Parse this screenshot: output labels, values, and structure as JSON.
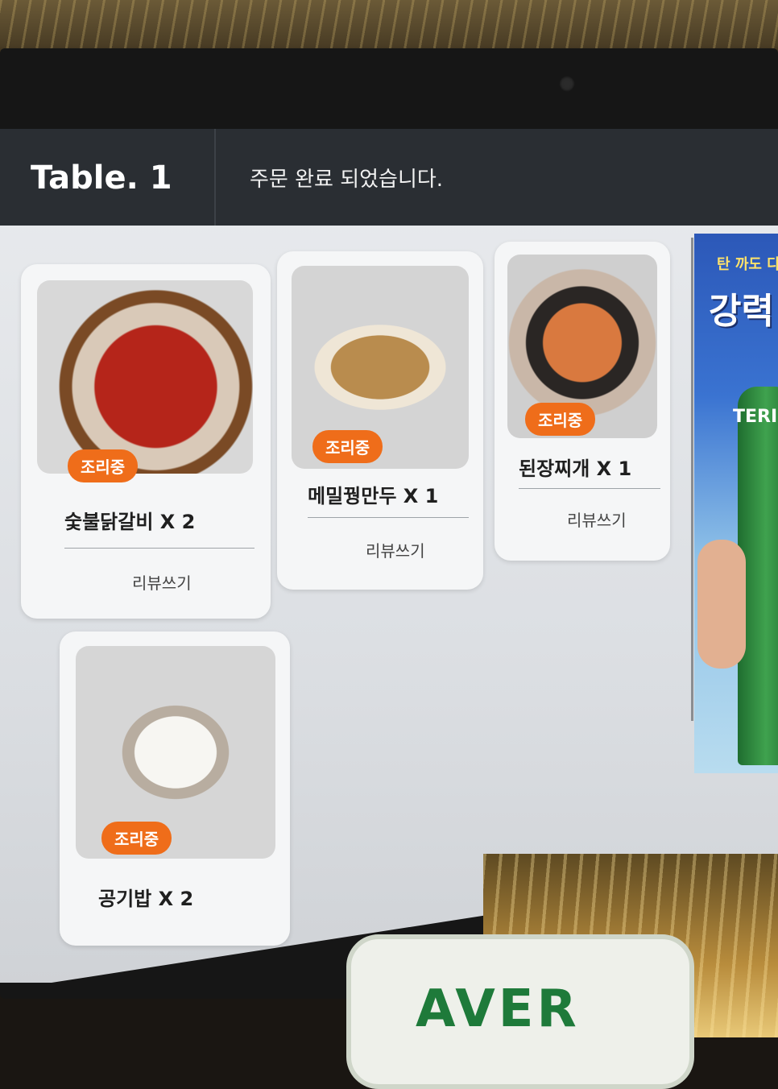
{
  "header": {
    "table_label": "Table. 1",
    "status_message": "주문 완료 되었습니다."
  },
  "orders": [
    {
      "name": "숯불닭갈비 X 2",
      "status": "조리중",
      "action": "리뷰쓰기",
      "icon": "spicy-chicken-photo"
    },
    {
      "name": "메밀꿩만두 X 1",
      "status": "조리중",
      "action": "리뷰쓰기",
      "icon": "dumplings-photo"
    },
    {
      "name": "된장찌개 X 1",
      "status": "조리중",
      "action": "리뷰쓰기",
      "icon": "soybean-stew-photo"
    },
    {
      "name": "공기밥 X 2",
      "status": "조리중",
      "icon": "rice-bowl-photo"
    }
  ],
  "ad": {
    "tagline": "탄 까도 다",
    "headline": "강력",
    "brand": "TERI"
  },
  "background_sign": {
    "text": "AVER"
  },
  "colors": {
    "badge": "#ef6d1a",
    "topbar": "#2a2e33",
    "screen": "#e9ebee"
  }
}
